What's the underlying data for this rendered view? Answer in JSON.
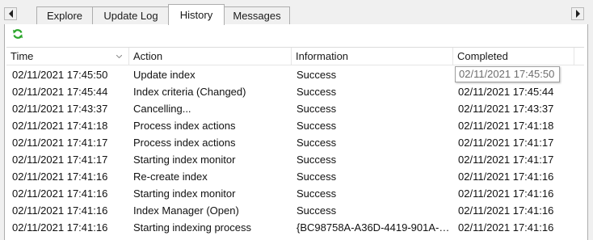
{
  "tabs": [
    {
      "label": "Explore",
      "active": false
    },
    {
      "label": "Update Log",
      "active": false
    },
    {
      "label": "History",
      "active": true
    },
    {
      "label": "Messages",
      "active": false
    }
  ],
  "toolbar": {
    "refresh_icon": "refresh-icon",
    "refresh_color": "#2aa52a"
  },
  "table": {
    "columns": [
      "Time",
      "Action",
      "Information",
      "Completed"
    ],
    "sorted_column": "Time",
    "rows": [
      {
        "time": "02/11/2021 17:45:50",
        "action": "Update index",
        "info": "Success",
        "completed": "02/11/2021 17:45:50"
      },
      {
        "time": "02/11/2021 17:45:44",
        "action": "Index criteria (Changed)",
        "info": "Success",
        "completed": "02/11/2021 17:45:44"
      },
      {
        "time": "02/11/2021 17:43:37",
        "action": "Cancelling...",
        "info": "Success",
        "completed": "02/11/2021 17:43:37"
      },
      {
        "time": "02/11/2021 17:41:18",
        "action": "Process index actions",
        "info": "Success",
        "completed": "02/11/2021 17:41:18"
      },
      {
        "time": "02/11/2021 17:41:17",
        "action": "Process index actions",
        "info": "Success",
        "completed": "02/11/2021 17:41:17"
      },
      {
        "time": "02/11/2021 17:41:17",
        "action": "Starting index monitor",
        "info": "Success",
        "completed": "02/11/2021 17:41:17"
      },
      {
        "time": "02/11/2021 17:41:16",
        "action": "Re-create index",
        "info": "Success",
        "completed": "02/11/2021 17:41:16"
      },
      {
        "time": "02/11/2021 17:41:16",
        "action": "Starting index monitor",
        "info": "Success",
        "completed": "02/11/2021 17:41:16"
      },
      {
        "time": "02/11/2021 17:41:16",
        "action": "Index Manager (Open)",
        "info": "Success",
        "completed": "02/11/2021 17:41:16"
      },
      {
        "time": "02/11/2021 17:41:16",
        "action": "Starting indexing process",
        "info": "{BC98758A-A36D-4419-901A-E...",
        "completed": "02/11/2021 17:41:16"
      }
    ]
  }
}
